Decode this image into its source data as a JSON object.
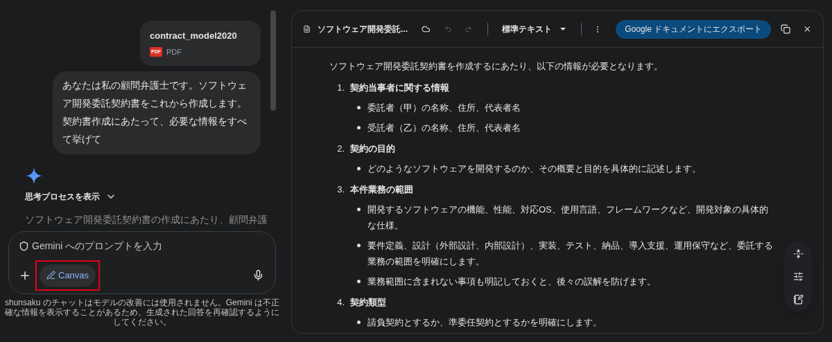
{
  "chat": {
    "attachment": {
      "name": "contract_model2020",
      "icon_label": "PDF",
      "type": "PDF"
    },
    "user_message": "あなたは私の顧問弁護士です。ソフトウェア開発委託契約書をこれから作成します。契約書作成にあたって、必要な情報をすべて挙げて",
    "thinking_toggle": {
      "label": "思考プロセスを表示",
      "expanded": false
    },
    "response_preview": "ソフトウェア開発委託契約書の作成にあたり、顧問弁護"
  },
  "prompt": {
    "placeholder": "Gemini へのプロンプトを入力",
    "canvas_button": {
      "label": "Canvas",
      "selected": true,
      "highlighted": true
    }
  },
  "disclaimer": "shunsaku のチャットはモデルの改善には使用されません。Gemini は不正確な情報を表示することがあるため、生成された回答を再確認するようにしてください。",
  "canvas": {
    "title": "ソフトウェア開発委託...",
    "undo": {
      "disabled": true
    },
    "redo": {
      "disabled": true
    },
    "style_dropdown": "標準テキスト",
    "export_button": "Google ドキュメントにエクスポート",
    "intro": "ソフトウェア開発委託契約書を作成するにあたり、以下の情報が必要となります。",
    "sections": [
      {
        "number": "1.",
        "title": "契約当事者に関する情報",
        "bullets": [
          "委託者（甲）の名称、住所、代表者名",
          "受託者（乙）の名称、住所、代表者名"
        ]
      },
      {
        "number": "2.",
        "title": "契約の目的",
        "bullets": [
          "どのようなソフトウェアを開発するのか、その概要と目的を具体的に記述します。"
        ]
      },
      {
        "number": "3.",
        "title": "本件業務の範囲",
        "bullets": [
          "開発するソフトウェアの機能、性能、対応OS、使用言語、フレームワークなど、開発対象の具体的な仕様。",
          "要件定義、設計（外部設計、内部設計）、実装、テスト、納品、導入支援、運用保守など、委託する業務の範囲を明確にします。",
          "業務範囲に含まれない事項も明記しておくと、後々の誤解を防げます。"
        ]
      },
      {
        "number": "4.",
        "title": "契約類型",
        "bullets": [
          "請負契約とするか、準委任契約とするかを明確にします。"
        ]
      }
    ]
  }
}
